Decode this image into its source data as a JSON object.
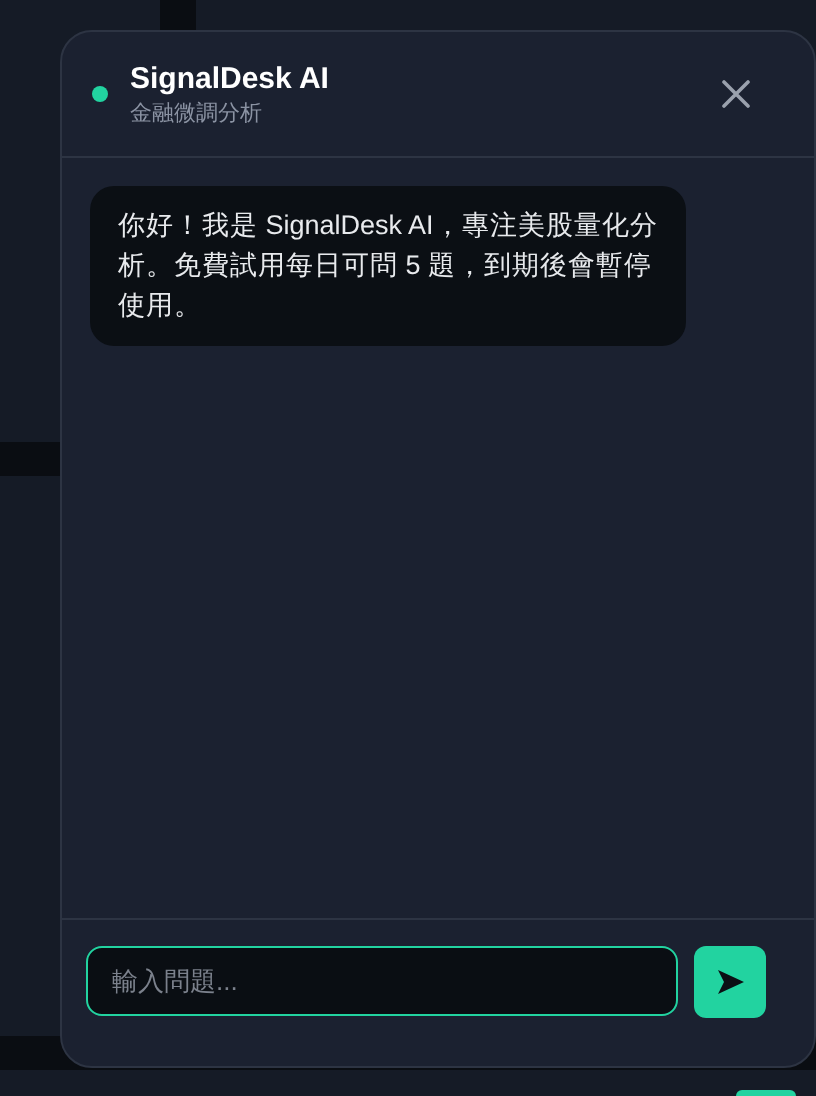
{
  "chat": {
    "title": "SignalDesk AI",
    "subtitle": "金融微調分析",
    "online": true
  },
  "messages": [
    {
      "kind": "received",
      "text": "你好！我是 SignalDesk AI，專注美股量化分析。免費試用每日可問 5 題，到期後會暫停使用。"
    }
  ],
  "input": {
    "placeholder": "輸入問題...",
    "focused": true
  }
}
